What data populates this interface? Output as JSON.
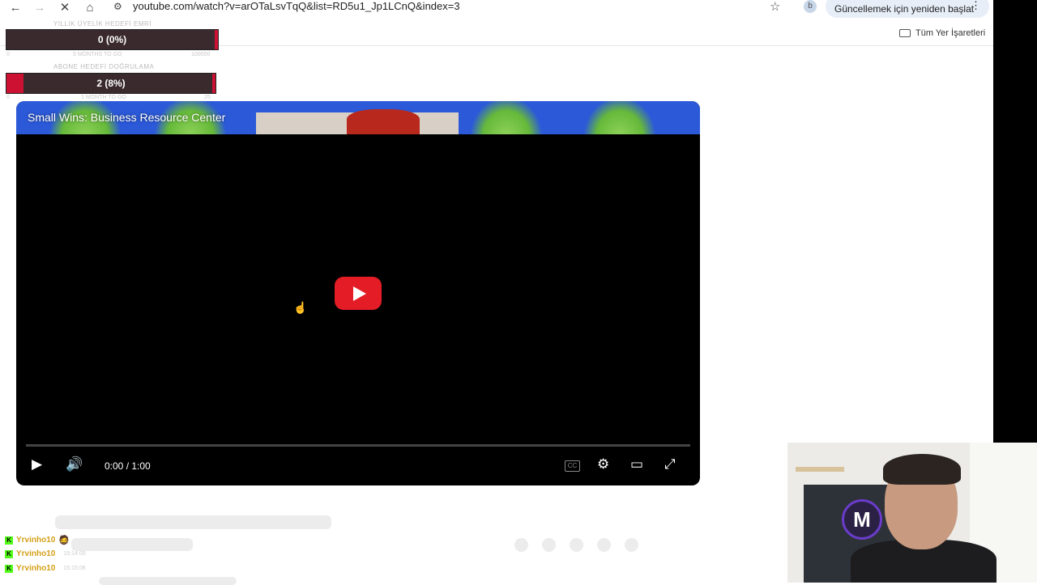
{
  "browser": {
    "url": "youtube.com/watch?v=arOTaLsvTqQ&list=RD5u1_Jp1LCnQ&index=3",
    "profile_initial": "b",
    "update_button": "Güncellemek için yeniden başlat",
    "bookmarks_all": "Tüm Yer İşaretleri"
  },
  "overlay_goals": [
    {
      "caption": "YILLIK ÜYELİK HEDEFİ EMRİ",
      "value": "0 (0%)",
      "progress": 0,
      "sub_left": "0",
      "sub_mid": "5 MONTHS TO GO",
      "sub_right": "100000"
    },
    {
      "caption": "ABONE HEDEFİ DOĞRULAMA",
      "value": "2 (8%)",
      "progress": 0.08,
      "sub_left": "0",
      "sub_mid": "1 MONTH TO GO",
      "sub_right": "25"
    }
  ],
  "player": {
    "video_title": "Small Wins: Business Resource Center",
    "time": "0:00 / 1:00"
  },
  "chat": [
    {
      "user": "Yrvinho10",
      "time": ""
    },
    {
      "user": "Yrvinho10",
      "time": "15:14:00"
    },
    {
      "user": "Yrvinho10",
      "time": "15:15:06"
    }
  ],
  "webcam": {
    "logo_text": "M"
  },
  "colors": {
    "goal_fill": "#cc1133",
    "yt_red": "#e41c26",
    "kick_green": "#53fc18"
  }
}
